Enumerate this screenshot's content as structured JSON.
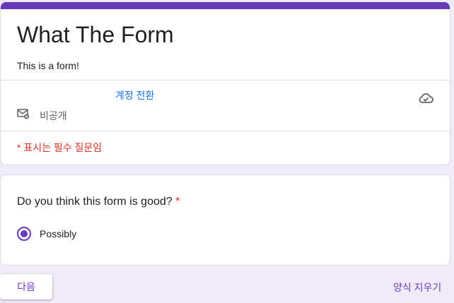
{
  "form": {
    "title": "What The Form",
    "description": "This is a form!",
    "switch_account": "계정 전환",
    "private_label": "비공개",
    "required_note": "* 표시는 필수 질문임"
  },
  "question": {
    "text": "Do you think this form is good?",
    "required_marker": "*",
    "options": [
      {
        "label": "Possibly",
        "selected": true
      }
    ]
  },
  "footer": {
    "next_label": "다음",
    "clear_label": "양식 지우기"
  },
  "colors": {
    "accent": "#673ab7",
    "background": "#f0ebf8",
    "link": "#1a73e8",
    "required": "#d93025"
  },
  "icons": {
    "email": "mail-icon",
    "cloud": "cloud-saved-icon"
  }
}
